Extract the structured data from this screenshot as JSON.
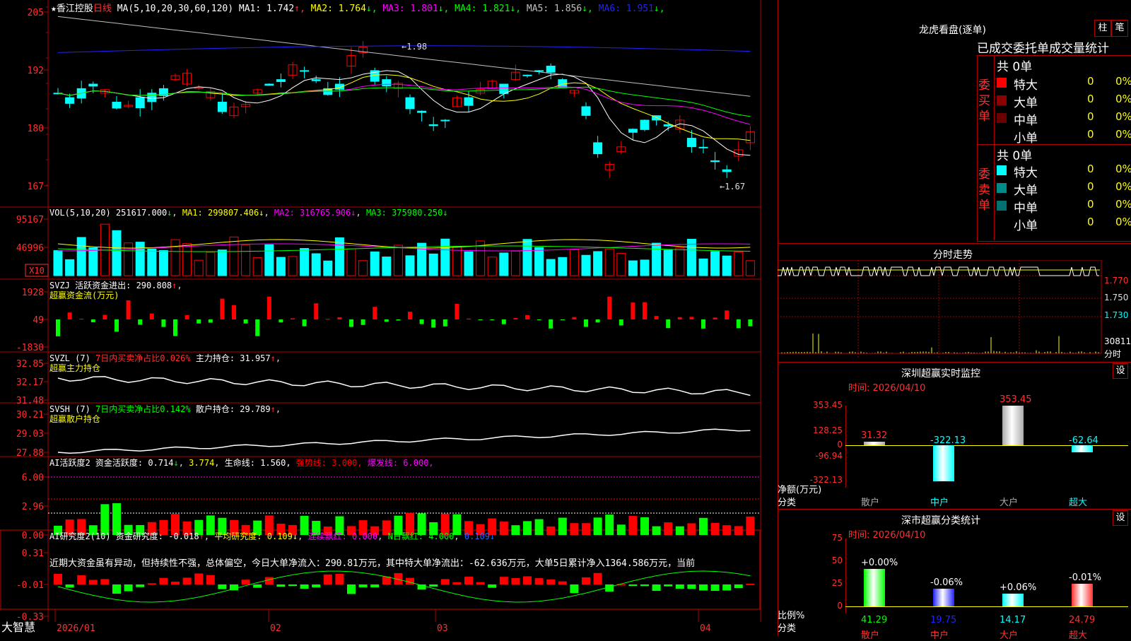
{
  "header": {
    "star": "★",
    "stock_name": "香江控股",
    "period": "日线",
    "ma_def": "MA(5,10,20,30,60,120)",
    "ma_values": [
      {
        "label": "MA1:",
        "value": "1.742",
        "arrow": "↑",
        "color": "#ffffff"
      },
      {
        "label": "MA2:",
        "value": "1.764",
        "arrow": "↓",
        "color": "#ffff00"
      },
      {
        "label": "MA3:",
        "value": "1.801",
        "arrow": "↓",
        "color": "#ff00ff"
      },
      {
        "label": "MA4:",
        "value": "1.821",
        "arrow": "↓",
        "color": "#00ff00"
      },
      {
        "label": "MA5:",
        "value": "1.856",
        "arrow": "↓",
        "color": "#c0c0c0"
      },
      {
        "label": "MA6:",
        "value": "1.951",
        "arrow": "↓",
        "color": "#2222ff"
      }
    ]
  },
  "price_axis": [
    "205",
    "192",
    "180",
    "167"
  ],
  "price_annotations": {
    "high": "1.98",
    "low": "1.67"
  },
  "vol_header": {
    "def": "VOL(5,10,20)",
    "value": "251617.000",
    "arrow": "↓",
    "ma1": "MA1: 299807.406",
    "ma2": "MA2: 316765.906",
    "ma3": "MA3: 375980.250"
  },
  "vol_axis": [
    "95167",
    "46996"
  ],
  "vol_unit": "X10",
  "svzj": {
    "title": "SVZJ  活跃资金进出:",
    "value": "290.808",
    "arrow": "↑",
    "sub": "超赢资金流(万元)",
    "axis": [
      "1928",
      "49",
      "-1830"
    ]
  },
  "svzl": {
    "title": "SVZL (7)",
    "note": "7日内买卖净占比0.026%",
    "label": "主力持仓:",
    "value": "31.957",
    "arrow": "↑",
    "sub": "超赢主力持仓",
    "axis": [
      "32.85",
      "32.17",
      "31.48"
    ]
  },
  "svsh": {
    "title": "SVSH (7)",
    "note": "7日内买卖净占比0.142%",
    "label": "散户持仓:",
    "value": "29.789",
    "arrow": "↑",
    "sub": "超赢散户持仓",
    "axis": [
      "30.21",
      "29.03",
      "27.88"
    ]
  },
  "ai_active": {
    "title": "AI活跃度2 资金活跃度:",
    "value1": "0.714",
    "arrow1": "↓",
    "value2": "3.774",
    "life_label": "生命线:",
    "life_value": "1.560",
    "strong_label": "强势线:",
    "strong_value": "3.000",
    "burst_label": "爆发线:",
    "burst_value": "6.000",
    "axis": [
      "6.00",
      "2.96",
      "0.00"
    ]
  },
  "ai_research": {
    "title": "AI研究度2(10) 资金研究度:",
    "value1": "-0.018",
    "arrow1": "↑",
    "avg_label": "平均研究度:",
    "avg_value": "0.109",
    "arrow2": "↓",
    "red_label": "连续飘红:",
    "red_value": "0.000",
    "n_label": "N日飘红:",
    "n_value": "4.000",
    "value3": "0.109",
    "arrow3": "↓",
    "comment": "近期大资金虽有异动，但持续性不强，总体偏空，今日大单净流入：290.81万元，其中特大单净流出：-62.636万元，大单5日累计净入1364.586万元，当前",
    "axis": [
      "0.31",
      "-0.01",
      "-0.33"
    ]
  },
  "date_axis": [
    "2026/01",
    "02",
    "03",
    "04"
  ],
  "brand": "大智慧",
  "right_panel": {
    "lhb_title": "龙虎看盘(逐单)",
    "tab_bar": "柱",
    "tab_pen": "笔",
    "stats_header": "已成交委托单成交量统计",
    "buy_side": "委买单",
    "sell_side": "委卖单",
    "buy_total": "共 0单",
    "sell_total": "共 0单",
    "buy_rows": [
      {
        "label": "特大",
        "count": "0",
        "pct": "0%",
        "color": "#ff0000"
      },
      {
        "label": "大单",
        "count": "0",
        "pct": "0%",
        "color": "#8b0000"
      },
      {
        "label": "中单",
        "count": "0",
        "pct": "0%",
        "color": "#6b0000"
      },
      {
        "label": "小单",
        "count": "0",
        "pct": "0%",
        "color": ""
      }
    ],
    "sell_rows": [
      {
        "label": "特大",
        "count": "0",
        "pct": "0%",
        "color": "#00ffff"
      },
      {
        "label": "大单",
        "count": "0",
        "pct": "0%",
        "color": "#008b8b"
      },
      {
        "label": "中单",
        "count": "0",
        "pct": "0%",
        "color": "#007070"
      },
      {
        "label": "小单",
        "count": "0",
        "pct": "0%",
        "color": ""
      }
    ],
    "intraday_title": "分时走势",
    "intraday_axis": [
      "1.770",
      "1.750",
      "1.730"
    ],
    "intraday_vol": "30811",
    "intraday_unit": "分时",
    "sz_monitor_title": "深圳超赢实时监控",
    "sz_settings": "设",
    "sz_time": "时间: 2026/04/10",
    "sz_axis": [
      "353.45",
      "128.25",
      "0",
      "-96.94",
      "-322.13"
    ],
    "sz_axis_label": "净额(万元)",
    "sz_cat_label": "分类",
    "sz_bars": [
      {
        "cat": "散户",
        "value": 31.32,
        "label": "31.32"
      },
      {
        "cat": "中户",
        "value": -322.13,
        "label": "-322.13"
      },
      {
        "cat": "大户",
        "value": 353.45,
        "label": "353.45"
      },
      {
        "cat": "超大",
        "value": -62.64,
        "label": "-62.64"
      }
    ],
    "market_title": "深市超赢分类统计",
    "market_settings": "设",
    "market_time": "时间: 2026/04/10",
    "market_axis": [
      "75",
      "50",
      "25",
      "0"
    ],
    "market_axis_label": "比例%",
    "market_cat_label": "分类",
    "market_bars": [
      {
        "cat": "散户",
        "value": 41.29,
        "label": "41.29",
        "change": "+0.00%"
      },
      {
        "cat": "中户",
        "value": 19.75,
        "label": "19.75",
        "change": "-0.06%"
      },
      {
        "cat": "大户",
        "value": 14.17,
        "label": "14.17",
        "change": "+0.06%"
      },
      {
        "cat": "超大",
        "value": 24.79,
        "label": "24.79",
        "change": "-0.01%"
      }
    ]
  },
  "colors": {
    "up": "#ff0000",
    "down": "#00ffff",
    "grid": "#a00000",
    "axis_text": "#ff3030"
  }
}
